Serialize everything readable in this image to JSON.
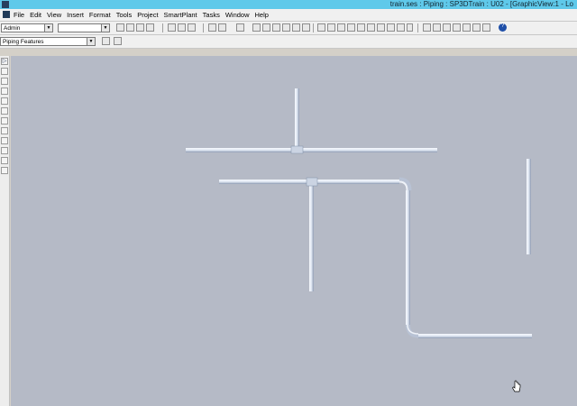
{
  "window": {
    "title": "train.ses : Piping : SP3DTrain : U02 - [GraphicView:1 - Lo"
  },
  "menu": [
    "File",
    "Edit",
    "View",
    "Insert",
    "Format",
    "Tools",
    "Project",
    "SmartPlant",
    "Tasks",
    "Window",
    "Help"
  ],
  "toolbar": {
    "workspace_combo": "Admin",
    "second_combo": "",
    "help_label": "?"
  },
  "feature_bar": {
    "combo": "Piping Features"
  },
  "icons": {
    "app": "sp3d-app-icon",
    "cursor": "hand-pointer-icon"
  },
  "colors": {
    "titlebar": "#5fc9ea",
    "canvas": "#b5bac6",
    "pipe": "#dfe7f3"
  }
}
